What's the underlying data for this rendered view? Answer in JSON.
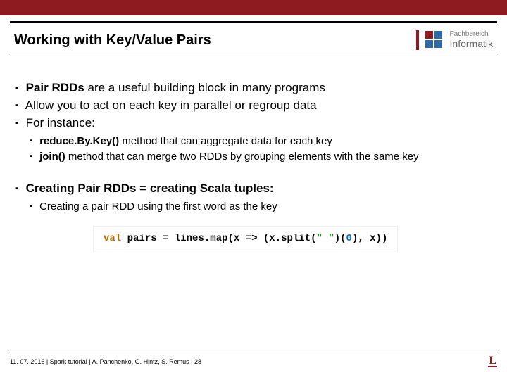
{
  "header": {
    "title": "Working with Key/Value Pairs",
    "logo": {
      "line1": "Fachbereich",
      "line2": "Informatik"
    }
  },
  "content": {
    "bullets_top": [
      {
        "bold": "Pair RDDs ",
        "rest": "are a useful building block in many programs"
      },
      {
        "bold": "",
        "rest": "Allow you to act on each key in parallel or regroup data"
      },
      {
        "bold": "",
        "rest": "For instance:"
      }
    ],
    "sub_bullets_top": [
      {
        "bold": "reduce.By.Key() ",
        "rest": "method that can aggregate data for each key"
      },
      {
        "bold": "join() ",
        "rest": "method that can merge two RDDs by grouping elements with the same key"
      }
    ],
    "bullet_mid": "Creating Pair RDDs = creating Scala tuples:",
    "sub_bullet_mid": "Creating a pair RDD using the first word as the key",
    "code": {
      "kw": "val",
      "ident1": " pairs ",
      "eq": "= ",
      "ident2": "lines.map(x ",
      "arrow": "=> ",
      "ident3": "(x.split(",
      "str": "\" \"",
      "mid": ")(",
      "num": "0",
      "end": "), x))"
    }
  },
  "footer": {
    "text": "11. 07. 2016 |  Spark tutorial |  A. Panchenko, G. Hintz, S. Remus  | 28",
    "logo": "L"
  }
}
